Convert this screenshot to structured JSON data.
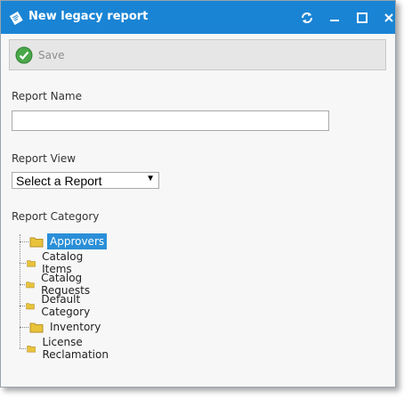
{
  "window": {
    "title": "New legacy report",
    "title_icon": "report-page-icon",
    "controls": [
      "refresh-icon",
      "minimize-icon",
      "maximize-icon",
      "close-icon"
    ]
  },
  "toolbar": {
    "save_label": "Save",
    "save_icon": "check-circle-icon"
  },
  "form": {
    "report_name_label": "Report Name",
    "report_name_value": "",
    "report_view_label": "Report View",
    "report_view_selected": "Select a Report",
    "report_category_label": "Report Category"
  },
  "tree": {
    "items": [
      {
        "label": "Approvers",
        "selected": true
      },
      {
        "label": "Catalog Items",
        "selected": false
      },
      {
        "label": "Catalog Requests",
        "selected": false
      },
      {
        "label": "Default Category",
        "selected": false
      },
      {
        "label": "Inventory",
        "selected": false
      },
      {
        "label": "License Reclamation",
        "selected": false
      }
    ]
  },
  "colors": {
    "titlebar": "#1a84d4",
    "selection": "#2a8fd8",
    "folder": "#e8c33a"
  }
}
